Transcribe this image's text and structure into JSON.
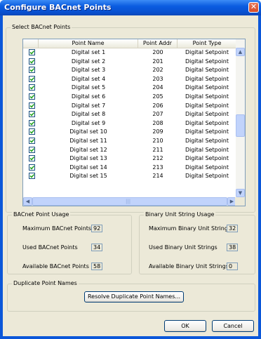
{
  "window": {
    "title": "Configure BACnet Points",
    "close_label": "✕"
  },
  "points_group": {
    "label": "Select BACnet Points",
    "columns": [
      "Point Name",
      "Point Addr",
      "Point Type"
    ],
    "rows": [
      {
        "checked": true,
        "name": "Digital set 1",
        "addr": "200",
        "type": "Digital Setpoint"
      },
      {
        "checked": true,
        "name": "Digital set 2",
        "addr": "201",
        "type": "Digital Setpoint"
      },
      {
        "checked": true,
        "name": "Digital set 3",
        "addr": "202",
        "type": "Digital Setpoint"
      },
      {
        "checked": true,
        "name": "Digital set 4",
        "addr": "203",
        "type": "Digital Setpoint"
      },
      {
        "checked": true,
        "name": "Digital set 5",
        "addr": "204",
        "type": "Digital Setpoint"
      },
      {
        "checked": true,
        "name": "Digital set 6",
        "addr": "205",
        "type": "Digital Setpoint"
      },
      {
        "checked": true,
        "name": "Digital set 7",
        "addr": "206",
        "type": "Digital Setpoint"
      },
      {
        "checked": true,
        "name": "Digital set 8",
        "addr": "207",
        "type": "Digital Setpoint"
      },
      {
        "checked": true,
        "name": "Digital set 9",
        "addr": "208",
        "type": "Digital Setpoint"
      },
      {
        "checked": true,
        "name": "Digital set 10",
        "addr": "209",
        "type": "Digital Setpoint"
      },
      {
        "checked": true,
        "name": "Digital set 11",
        "addr": "210",
        "type": "Digital Setpoint"
      },
      {
        "checked": true,
        "name": "Digital set 12",
        "addr": "211",
        "type": "Digital Setpoint"
      },
      {
        "checked": true,
        "name": "Digital set 13",
        "addr": "212",
        "type": "Digital Setpoint"
      },
      {
        "checked": true,
        "name": "Digital set 14",
        "addr": "213",
        "type": "Digital Setpoint"
      },
      {
        "checked": true,
        "name": "Digital set 15",
        "addr": "214",
        "type": "Digital Setpoint"
      }
    ],
    "scroll_icons": {
      "up": "▲",
      "down": "▼",
      "left": "◀",
      "right": "▶",
      "grip": "|||"
    }
  },
  "usage": {
    "label": "BACnet Point Usage",
    "max_label": "Maximum BACnet Points",
    "max_value": "92",
    "used_label": "Used BACnet Points",
    "used_value": "34",
    "avail_label": "Available BACnet Points",
    "avail_value": "58"
  },
  "binary": {
    "label": "Binary Unit String Usage",
    "max_label": "Maximum Binary Unit Strings",
    "max_value": "32",
    "used_label": "Used Binary Unit Strings",
    "used_value": "38",
    "avail_label": "Available Binary Unit Strings",
    "avail_value": "0"
  },
  "duplicate": {
    "label": "Duplicate Point Names",
    "button": "Resolve Duplicate Point Names..."
  },
  "footer": {
    "ok": "OK",
    "cancel": "Cancel"
  },
  "colors": {
    "titlebar": "#0a5ce0",
    "client": "#ece9d8",
    "close": "#d44a25"
  },
  "icons": {
    "close": "close-icon",
    "check": "checkmark-icon"
  }
}
